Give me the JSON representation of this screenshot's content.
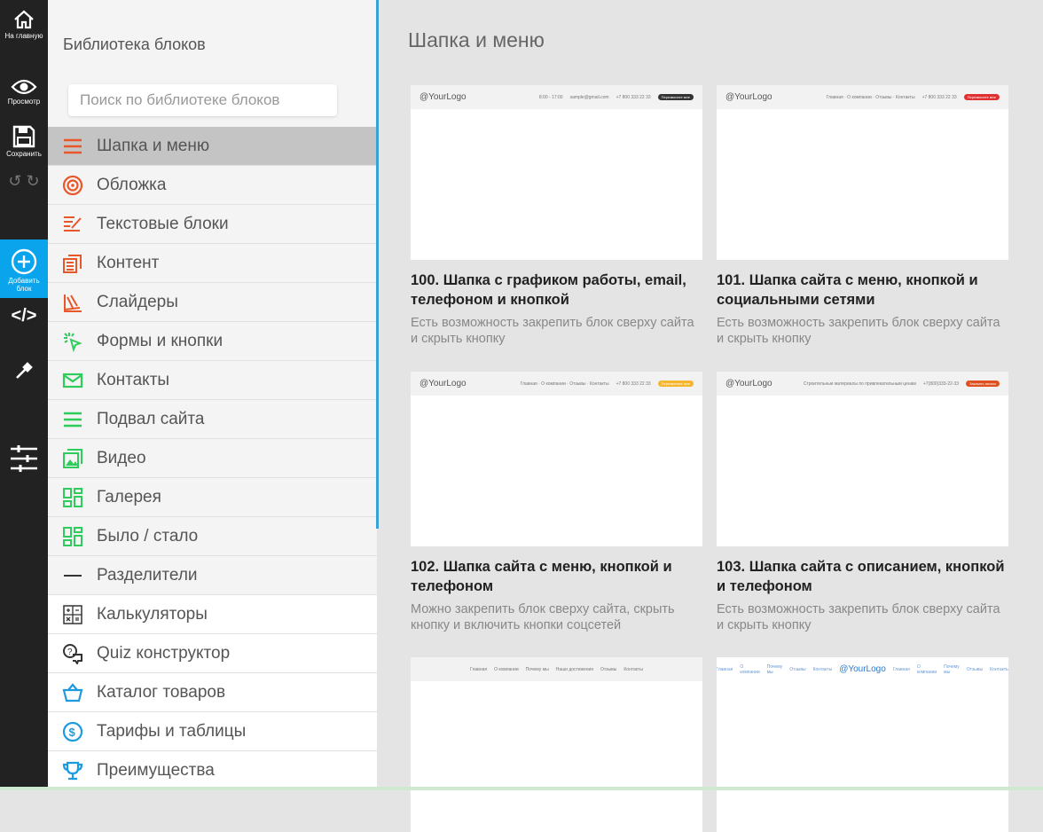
{
  "toolbar": {
    "home": "На главную",
    "preview": "Просмотр",
    "save": "Сохранить",
    "add_block_1": "Добавить",
    "add_block_2": "блок"
  },
  "panel": {
    "title": "Библиотека блоков",
    "search_placeholder": "Поиск по библиотеке блоков",
    "categories": [
      {
        "label": "Шапка и меню",
        "icon": "menu-icon",
        "color": "#e8572a"
      },
      {
        "label": "Обложка",
        "icon": "target-icon",
        "color": "#e8572a"
      },
      {
        "label": "Текстовые блоки",
        "icon": "edit-text-icon",
        "color": "#e8572a"
      },
      {
        "label": "Контент",
        "icon": "content-icon",
        "color": "#e8572a"
      },
      {
        "label": "Слайдеры",
        "icon": "slider-icon",
        "color": "#e8572a"
      },
      {
        "label": "Формы и кнопки",
        "icon": "click-icon",
        "color": "#2ecc5a"
      },
      {
        "label": "Контакты",
        "icon": "mail-icon",
        "color": "#2ecc5a"
      },
      {
        "label": "Подвал сайта",
        "icon": "footer-icon",
        "color": "#2ecc5a"
      },
      {
        "label": "Видео",
        "icon": "image-icon",
        "color": "#2ecc5a"
      },
      {
        "label": "Галерея",
        "icon": "gallery-icon",
        "color": "#2ecc5a"
      },
      {
        "label": "Было / стало",
        "icon": "before-after-icon",
        "color": "#2ecc5a"
      },
      {
        "label": "Разделители",
        "icon": "divider-icon",
        "color": "#333333"
      },
      {
        "label": "Калькуляторы",
        "icon": "calculator-icon",
        "color": "#333333"
      },
      {
        "label": "Quiz конструктор",
        "icon": "quiz-icon",
        "color": "#333333"
      },
      {
        "label": "Каталог товаров",
        "icon": "basket-icon",
        "color": "#1e9be0"
      },
      {
        "label": "Тарифы и таблицы",
        "icon": "dollar-icon",
        "color": "#1e9be0"
      },
      {
        "label": "Преимущества",
        "icon": "trophy-icon",
        "color": "#1e9be0"
      }
    ]
  },
  "main": {
    "title": "Шапка и меню",
    "cards": [
      {
        "title": "100. Шапка с графиком работы, email, телефоном и кнопкой",
        "desc": "Есть возможность закрепить блок сверху сайта и скрыть кнопку",
        "logo": "@YourLogo",
        "items": [
          "8:00 - 17:00",
          "sample@gmail.com",
          "+7 800 333 22 33"
        ],
        "button": "Перезвоните мне"
      },
      {
        "title": "101. Шапка сайта с меню, кнопкой и социальными сетями",
        "desc": "Есть возможность закрепить блок сверху сайта и скрыть кнопку",
        "logo": "@YourLogo",
        "items": [
          "Главная · О компании · Отзывы · Контакты",
          "+7 800 333 22 33"
        ],
        "button": "Перезвоните мне"
      },
      {
        "title": "102. Шапка сайта с меню, кнопкой и телефоном",
        "desc": "Можно закрепить блок сверху сайта, скрыть кнопку и включить кнопки соцсетей",
        "logo": "@YourLogo",
        "items": [
          "Главная · О компании · Отзывы · Контакты",
          "+7 800 333 22 33"
        ],
        "button": "Перезвоните мне"
      },
      {
        "title": "103. Шапка сайта с описанием, кнопкой и телефоном",
        "desc": "Есть возможность закрепить блок сверху сайта и скрыть кнопку",
        "logo": "@YourLogo",
        "items": [
          "Строительные материалы по привлекательным ценам",
          "+7(800)333-22-33"
        ],
        "button": "Заказать звонок"
      },
      {
        "items": [
          "Главная",
          "О компании",
          "Почему мы",
          "Наши достижения",
          "Отзывы",
          "Контакты"
        ]
      },
      {
        "logo": "@YourLogo",
        "items": [
          "Главная",
          "О компании",
          "Почему мы",
          "Отзывы",
          "Контакты"
        ]
      }
    ]
  }
}
